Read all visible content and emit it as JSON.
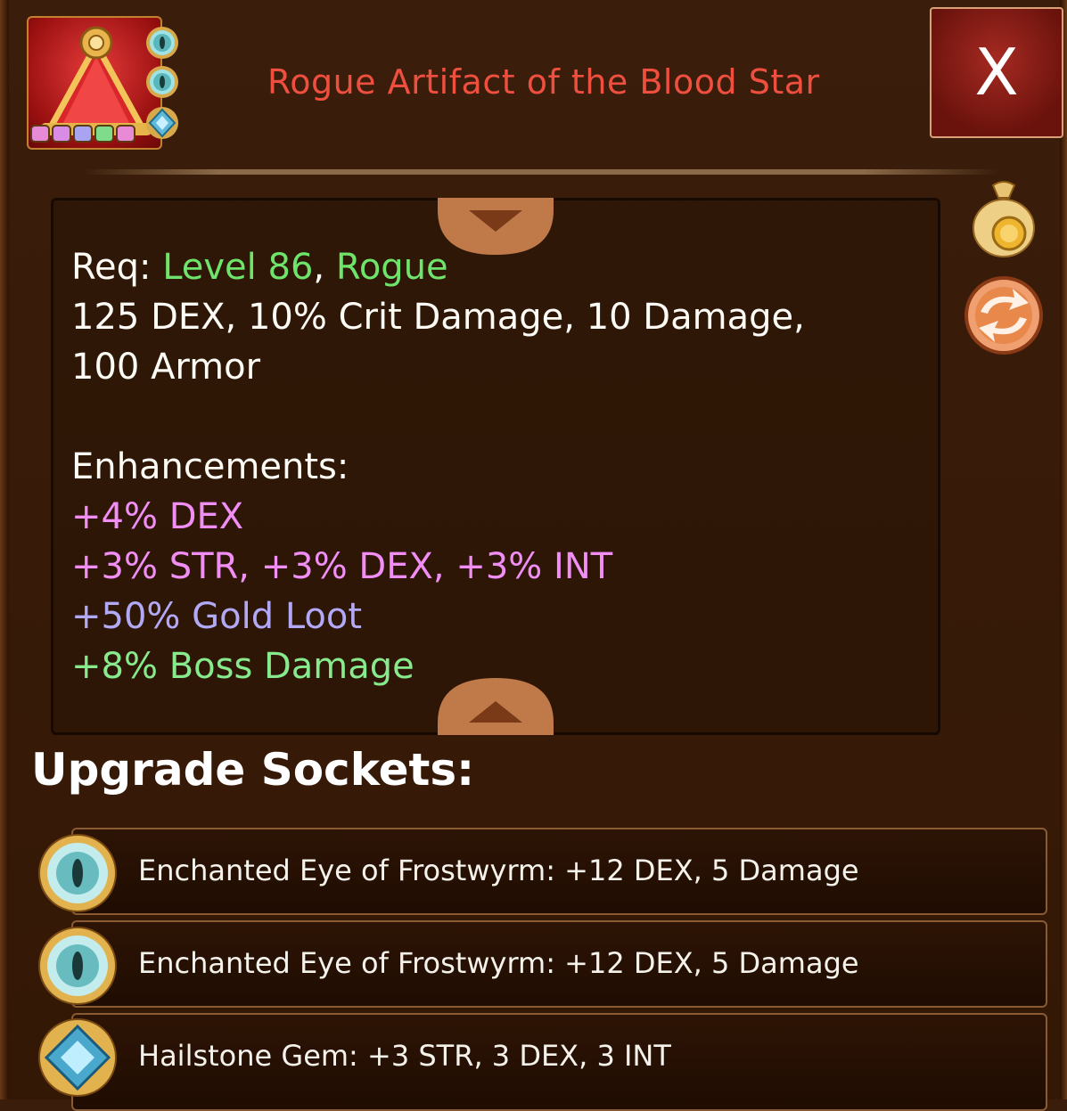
{
  "item": {
    "title": "Rogue Artifact of the Blood Star",
    "icon": "red-triangle-artifact-icon",
    "sockets_icons": [
      "frostwyrm-eye-icon",
      "frostwyrm-eye-icon",
      "hailstone-gem-icon"
    ],
    "rarity_colors": [
      "#e88ad6",
      "#d98ce6",
      "#a8a4f2",
      "#7fdc8a"
    ]
  },
  "close_label": "X",
  "stats": {
    "req_label": "Req: ",
    "req_level": "Level 86",
    "req_sep": ", ",
    "req_class": "Rogue",
    "base_line1": "125 DEX, 10% Crit Damage, 10 Damage,",
    "base_line2": "100 Armor",
    "enh_label": "Enhancements:",
    "enhancements": [
      {
        "text": "+4% DEX",
        "color": "#f08ef5"
      },
      {
        "text": "+3% STR, +3% DEX, +3% INT",
        "color": "#f08ef5"
      },
      {
        "text": "+50% Gold Loot",
        "color": "#b2a9f6"
      },
      {
        "text": "+8% Boss Damage",
        "color": "#87ea8c"
      }
    ]
  },
  "side_buttons": {
    "sell": "gold-bag-icon",
    "swap": "swap-arrows-icon"
  },
  "sockets_title": "Upgrade Sockets:",
  "sockets": [
    {
      "text": "Enchanted Eye of Frostwyrm: +12 DEX, 5 Damage",
      "icon": "frostwyrm-eye-icon"
    },
    {
      "text": "Enchanted Eye of Frostwyrm: +12 DEX, 5 Damage",
      "icon": "frostwyrm-eye-icon"
    },
    {
      "text": "Hailstone Gem: +3 STR, 3 DEX, 3 INT",
      "icon": "hailstone-gem-icon"
    }
  ]
}
